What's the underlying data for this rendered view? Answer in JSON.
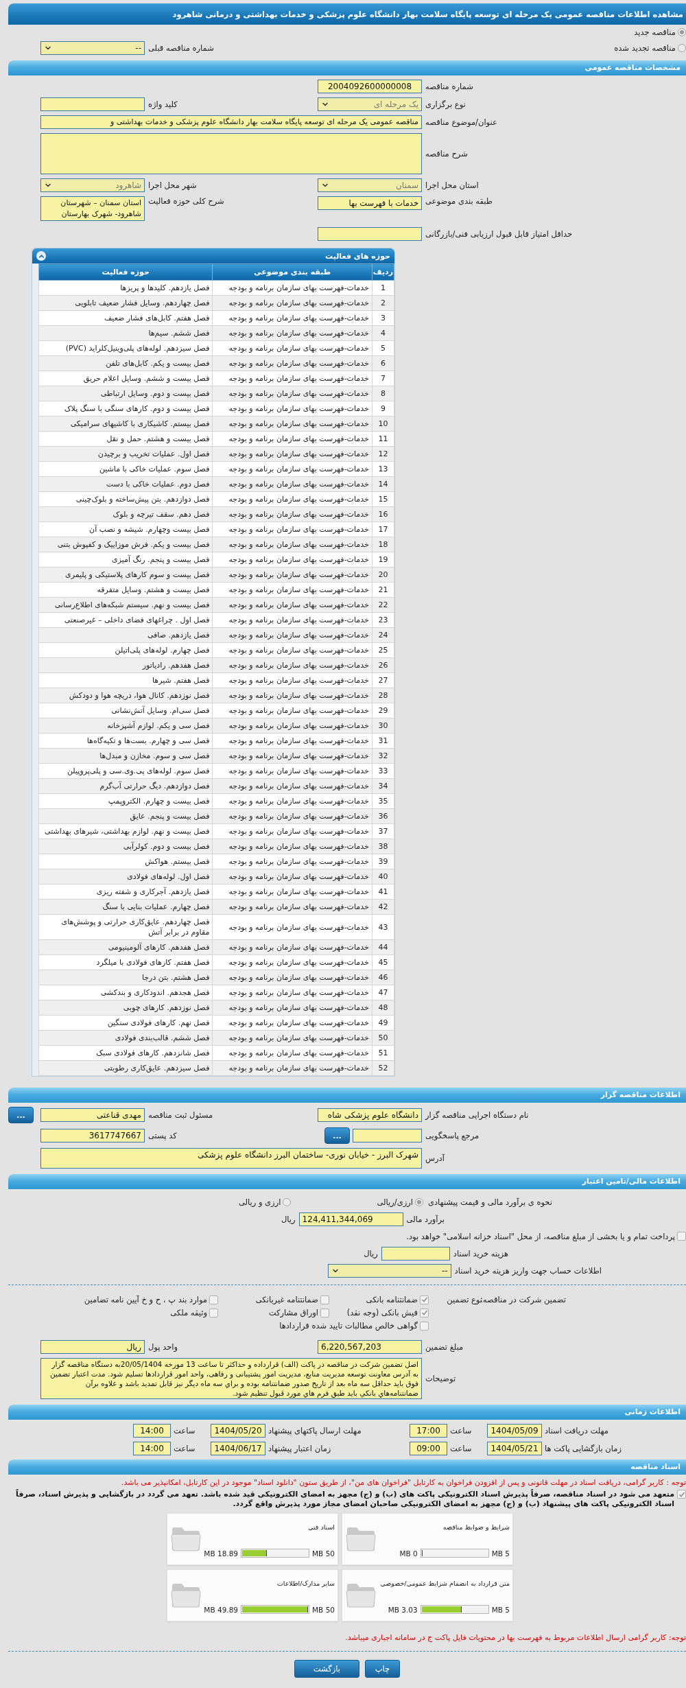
{
  "header": {
    "title": "مشاهده اطلاعات مناقصه عمومی یک مرحله ای توسعه پایگاه سلامت بهار دانشگاه علوم پزشکی و خدمات بهداشتی و درمانی شاهرود"
  },
  "tender_kind": [
    {
      "label": "مناقصه جدید",
      "selected": true
    },
    {
      "label": "مناقصه تجدید شده",
      "selected": false
    }
  ],
  "previous_tender": {
    "label": "شماره مناقصه قبلی",
    "value": "--"
  },
  "general": {
    "title": "مشخصات مناقصه عمومی",
    "number": {
      "label": "شماره مناقصه",
      "value": "2004092600000008"
    },
    "holding_type": {
      "label": "نوع برگزاری",
      "value": "یک مرحله ای"
    },
    "keyword": {
      "label": "کلید واژه"
    },
    "subject": {
      "label": "عنوان/موضوع مناقصه",
      "value": "مناقصه عمومی یک مرحله ای توسعه پایگاه سلامت بهار دانشگاه علوم پزشکی و خدمات بهداشتی و"
    },
    "description": {
      "label": "شرح مناقصه"
    },
    "province": {
      "label": "استان محل اجرا",
      "value": "سمنان"
    },
    "city": {
      "label": "شهر محل اجرا",
      "value": "شاهرود"
    },
    "category": {
      "label": "طبقه بندی موضوعی",
      "value": "خدمات با فهرست بها"
    },
    "scope": {
      "label": "شرح کلی حوزه فعالیت",
      "value": "استان سمنان – شهرستان شاهرود- شهرک بهارستان"
    },
    "min_score": {
      "label": "حداقل امتیاز قابل قبول ارزیابی فنی/بازرگانی"
    }
  },
  "activities": {
    "title": "حوزه های فعالیت",
    "columns": [
      "ردیف",
      "طبقه بندی موضوعی",
      "حوزه فعالیت"
    ],
    "rows": [
      [
        "1",
        "خدمات-فهرست بهای سازمان برنامه و بودجه",
        "فصل یازدهم. کلیدها و پریزها"
      ],
      [
        "2",
        "خدمات-فهرست بهای سازمان برنامه و بودجه",
        "فصل چهاردهم. وسایل فشار ضعیف تابلویی"
      ],
      [
        "3",
        "خدمات-فهرست بهای سازمان برنامه و بودجه",
        "فصل هفتم. کابل‌های فشار ضعیف"
      ],
      [
        "4",
        "خدمات-فهرست بهای سازمان برنامه و بودجه",
        "فصل ششم. سیم‌ها"
      ],
      [
        "5",
        "خدمات-فهرست بهای سازمان برنامه و بودجه",
        "فصل سیزدهم. لوله‌های پلی‌وینیل‌کلراید (PVC)"
      ],
      [
        "6",
        "خدمات-فهرست بهای سازمان برنامه و بودجه",
        "فصل بیست و یکم. کابل‌های تلفن"
      ],
      [
        "7",
        "خدمات-فهرست بهای سازمان برنامه و بودجه",
        "فصل بیست و ششم. وسایل اعلام حریق"
      ],
      [
        "8",
        "خدمات-فهرست بهای سازمان برنامه و بودجه",
        "فصل بیست و دوم. وسایل ارتباطی"
      ],
      [
        "9",
        "خدمات-فهرست بهای سازمان برنامه و بودجه",
        "فصل بیست و دوم. کارهای سنگی با سنگ پلاک"
      ],
      [
        "10",
        "خدمات-فهرست بهای سازمان برنامه و بودجه",
        "فصل بیستم. کاشیکاری با کاشیهای سرامیکی"
      ],
      [
        "11",
        "خدمات-فهرست بهای سازمان برنامه و بودجه",
        "فصل بیست و هشتم. حمل و نقل"
      ],
      [
        "12",
        "خدمات-فهرست بهای سازمان برنامه و بودجه",
        "فصل اول. عملیات تخریب و برچیدن"
      ],
      [
        "13",
        "خدمات-فهرست بهای سازمان برنامه و بودجه",
        "فصل سوم. عملیات خاکی با ماشین"
      ],
      [
        "14",
        "خدمات-فهرست بهای سازمان برنامه و بودجه",
        "فصل دوم. عملیات خاکی با دست"
      ],
      [
        "15",
        "خدمات-فهرست بهای سازمان برنامه و بودجه",
        "فصل دوازدهم. بتن پیش‌ساخته و بلوک‌چینی"
      ],
      [
        "16",
        "خدمات-فهرست بهای سازمان برنامه و بودجه",
        "فصل دهم. سقف تیرچه و بلوک"
      ],
      [
        "17",
        "خدمات-فهرست بهای سازمان برنامه و بودجه",
        "فصل بیست وچهارم. شیشه و نصب آن"
      ],
      [
        "18",
        "خدمات-فهرست بهای سازمان برنامه و بودجه",
        "فصل بیست و یکم. فرش موزاییک و کفپوش بتنی"
      ],
      [
        "19",
        "خدمات-فهرست بهای سازمان برنامه و بودجه",
        "فصل بیست و پنجم. رنگ آمیزی"
      ],
      [
        "20",
        "خدمات-فهرست بهای سازمان برنامه و بودجه",
        "فصل بیست و سوم کارهای پلاستیکی و پلیمری"
      ],
      [
        "21",
        "خدمات-فهرست بهای سازمان برنامه و بودجه",
        "فصل بیست و هشتم. وسایل متفرقه"
      ],
      [
        "22",
        "خدمات-فهرست بهای سازمان برنامه و بودجه",
        "فصل بیست و نهم. سیستم شبکه‌های اطلاع‌رسانی"
      ],
      [
        "23",
        "خدمات-فهرست بهای سازمان برنامه و بودجه",
        "فصل اول . چراغهای فضای داخلی – غیرصنعتی"
      ],
      [
        "24",
        "خدمات-فهرست بهای سازمان برنامه و بودجه",
        "فصل یازدهم. صافی"
      ],
      [
        "25",
        "خدمات-فهرست بهای سازمان برنامه و بودجه",
        "فصل چهارم. لوله‌های پلی‌اتیلن"
      ],
      [
        "26",
        "خدمات-فهرست بهای سازمان برنامه و بودجه",
        "فصل هفدهم. رادیاتور"
      ],
      [
        "27",
        "خدمات-فهرست بهای سازمان برنامه و بودجه",
        "فصل هفتم. شیرها"
      ],
      [
        "28",
        "خدمات-فهرست بهای سازمان برنامه و بودجه",
        "فصل نوزدهم. کانال هوا، دریچه هوا و دودکش"
      ],
      [
        "29",
        "خدمات-فهرست بهای سازمان برنامه و بودجه",
        "فصل سی‌ام. وسایل آتش‌نشانی"
      ],
      [
        "30",
        "خدمات-فهرست بهای سازمان برنامه و بودجه",
        "فصل سی و یکم. لوازم آشپزخانه"
      ],
      [
        "31",
        "خدمات-فهرست بهای سازمان برنامه و بودجه",
        "فصل سی و چهارم. بست‌ها و تکیه‌گاه‌ها"
      ],
      [
        "32",
        "خدمات-فهرست بهای سازمان برنامه و بودجه",
        "فصل سی و سوم. مخازن و مبدل‌ها"
      ],
      [
        "33",
        "خدمات-فهرست بهای سازمان برنامه و بودجه",
        "فصل سوم. لوله‌های پی.وی.سی و پلی‌پروپیلن"
      ],
      [
        "34",
        "خدمات-فهرست بهای سازمان برنامه و بودجه",
        "فصل دوازدهم. دیگ حرارتی آب‌گرم"
      ],
      [
        "35",
        "خدمات-فهرست بهای سازمان برنامه و بودجه",
        "فصل بیست و چهارم. الکتروپمپ"
      ],
      [
        "36",
        "خدمات-فهرست بهای سازمان برنامه و بودجه",
        "فصل بیست و پنجم. عایق"
      ],
      [
        "37",
        "خدمات-فهرست بهای سازمان برنامه و بودجه",
        "فصل بیست و نهم. لوازم بهداشتی، شیرهای بهداشتی"
      ],
      [
        "38",
        "خدمات-فهرست بهای سازمان برنامه و بودجه",
        "فصل بیست و دوم. کولرآبی"
      ],
      [
        "39",
        "خدمات-فهرست بهای سازمان برنامه و بودجه",
        "فصل بیستم. هواکش"
      ],
      [
        "40",
        "خدمات-فهرست بهای سازمان برنامه و بودجه",
        "فصل اول. لوله‌های فولادی"
      ],
      [
        "41",
        "خدمات-فهرست بهای سازمان برنامه و بودجه",
        "فصل یازدهم. آجرکاری و شفته ریزی"
      ],
      [
        "42",
        "خدمات-فهرست بهای سازمان برنامه و بودجه",
        "فصل چهارم. عملیات بنایی با سنگ"
      ],
      [
        "43",
        "خدمات-فهرست بهای سازمان برنامه و بودجه",
        "فصل چهاردهم. عایق‌کاری حرارتی و پوشش‌های مقاوم در برابر آتش"
      ],
      [
        "44",
        "خدمات-فهرست بهای سازمان برنامه و بودجه",
        "فصل هفدهم. کارهای آلومینیومی"
      ],
      [
        "45",
        "خدمات-فهرست بهای سازمان برنامه و بودجه",
        "فصل هفتم. کارهای فولادی با میلگرد"
      ],
      [
        "46",
        "خدمات-فهرست بهای سازمان برنامه و بودجه",
        "فصل هشتم. بتن درجا"
      ],
      [
        "47",
        "خدمات-فهرست بهای سازمان برنامه و بودجه",
        "فصل هجدهم. اندودکاری و بندکشی"
      ],
      [
        "48",
        "خدمات-فهرست بهای سازمان برنامه و بودجه",
        "فصل نوزدهم. کارهای چوبی"
      ],
      [
        "49",
        "خدمات-فهرست بهای سازمان برنامه و بودجه",
        "فصل نهم. کارهای فولادی سنگین"
      ],
      [
        "50",
        "خدمات-فهرست بهای سازمان برنامه و بودجه",
        "فصل ششم. قالب‌بندی فولادی"
      ],
      [
        "51",
        "خدمات-فهرست بهای سازمان برنامه و بودجه",
        "فصل شانزدهم. کارهای فولادی سبک"
      ],
      [
        "52",
        "خدمات-فهرست بهای سازمان برنامه و بودجه",
        "فصل سیزدهم. عایق‌کاری رطوبتی"
      ]
    ]
  },
  "organizer": {
    "title": "اطلاعات مناقصه گزار",
    "agency": {
      "label": "نام دستگاه اجرایی مناقصه گزار",
      "value": "دانشگاه علوم پزشکی شاه"
    },
    "registrar": {
      "label": "مسئول ثبت مناقصه",
      "value": "مهدی قناعتی",
      "button": "..."
    },
    "reference": {
      "label": "مرجع پاسخگویی",
      "button": "..."
    },
    "postal_code": {
      "label": "کد پستی",
      "value": "3617747667"
    },
    "address": {
      "label": "آدرس",
      "value": "شهرک البرز - خیابان نوری- ساختمان البرز دانشگاه علوم پزشکی"
    }
  },
  "finance": {
    "title": "اطلاعات مالی/تامین اعتبار",
    "estimate_method": {
      "label": "نحوه ی برآورد مالی و قیمت پیشنهادی",
      "options": [
        {
          "label": "ارزی/ریالی",
          "selected": true
        },
        {
          "label": "ارزی و ریالی",
          "selected": false
        }
      ]
    },
    "estimate": {
      "label": "برآورد مالی",
      "value": "124,411,344,069",
      "unit": "ریال"
    },
    "treasury": {
      "label": "پرداخت تمام و یا بخشی از مبلغ مناقصه، از محل \"اسناد خزانه اسلامی\" خواهد بود.",
      "checked": false
    },
    "doc_fee": {
      "label": "هزینه خرید اسناد",
      "unit": "ریال"
    },
    "account": {
      "label": "اطلاعات حساب جهت واریز هزینه خرید اسناد",
      "value": "--"
    }
  },
  "guarantee": {
    "label": "تضمین شرکت در مناقصه:",
    "type_label": "نوع تضمین",
    "options": [
      {
        "label": "ضمانتنامه بانکی",
        "checked": true
      },
      {
        "label": "ضمانتنامه غیربانکی",
        "checked": false
      },
      {
        "label": "موارد بند پ ، ح و خ آیین نامه تضامین",
        "checked": false
      },
      {
        "label": "فیش بانکی (وجه نقد)",
        "checked": true
      },
      {
        "label": "اوراق مشارکت",
        "checked": false
      },
      {
        "label": "وثیقه ملکی",
        "checked": false
      },
      {
        "label": "گواهی خالص مطالبات تایید شده قراردادها",
        "checked": false
      }
    ],
    "amount": {
      "label": "مبلغ تضمین",
      "value": "6,220,567,203"
    },
    "currency": {
      "label": "واحد پول",
      "value": "ریال"
    },
    "notes": {
      "label": "توضیحات",
      "value": "اصل تضمین شرکت در مناقصه در پاکت (الف) قرارداده و حداکثر تا ساعت 13 مورخه 20/05/1404به دستگاه مناقصه گزار به آدرس معاونت توسعه مدیریت منابع، مدیریت امور پشتیبانی و رفاهی، واحد امور قراردادها تسلیم شود. مدت اعتبار تضمین فوق باید حداقل سه ماه بعد از تاریخ صدور ضمانتنامه بوده و براي سه ماه ديگر نيز قابل تمدید باشد و علاوه برآن ضمانتنامه‌هاي  بانکي بايد طبق فرم هاي مورد قبول تنظيم شود."
    }
  },
  "schedule": {
    "title": "اطلاعات زمانی",
    "rows": [
      [
        {
          "label": "مهلت دریافت اسناد",
          "date": "1404/05/09",
          "time_label": "ساعت",
          "time": "17:00"
        },
        {
          "label": "مهلت ارسال پاکتهای پیشنهاد",
          "date": "1404/05/20",
          "time_label": "ساعت",
          "time": "14:00"
        }
      ],
      [
        {
          "label": "زمان بازگشایی پاکت ها",
          "date": "1404/05/21",
          "time_label": "ساعت",
          "time": "09:00"
        },
        {
          "label": "زمان اعتبار پیشنهاد",
          "date": "1404/06/17",
          "time_label": "ساعت",
          "time": "14:00"
        }
      ]
    ]
  },
  "documents": {
    "title": "اسناد مناقصه",
    "notice": "توجه : کاربر گرامی، دریافت اسناد در مهلت قانونی و پس از افزودن فراخوان به کارتابل \"فراخوان های من\"، از طریق ستون \"دانلود اسناد\" موجود در این کارتابل، امکانپذیر می باشد.",
    "commitment": {
      "text": "متعهد می شود در اسناد مناقصه، صرفاً پذیرش اسناد الکترونیکی پاکت های (ب) و (ج) مجهز به امضای الکترونیکی قید شده باشد. تعهد می گردد در بازگشایی و پذیرش اسناد، صرفاً اسناد الکترونیکی پاکت های پیشنهاد (ب) و (ج) مجهز به امضای الکترونیکی صاحبان امضای مجاز مورد پذیرش واقع گردد.",
      "checked": true
    },
    "files": [
      {
        "title": "شرایط و ضوابط مناقصه",
        "used": "0 MB",
        "max": "5 MB",
        "level": 0
      },
      {
        "title": "اسناد فنی",
        "used": "18.89 MB",
        "max": "50 MB",
        "level": 0.378
      },
      {
        "title": "متن قرارداد به انضمام شرایط عمومی/خصوصی",
        "used": "3.03 MB",
        "max": "5 MB",
        "level": 0.606
      },
      {
        "title": "سایر مدارک/اطلاعات",
        "used": "49.89 MB",
        "max": "50 MB",
        "level": 0.998
      }
    ],
    "footnote": "توجه: کاربر گرامی ارسال اطلاعات مربوط به فهرست بها در محتویات فایل پاکت ج در سامانه اجباری میباشد."
  },
  "actions": [
    {
      "label": "چاپ"
    },
    {
      "label": "بازگشت"
    }
  ]
}
